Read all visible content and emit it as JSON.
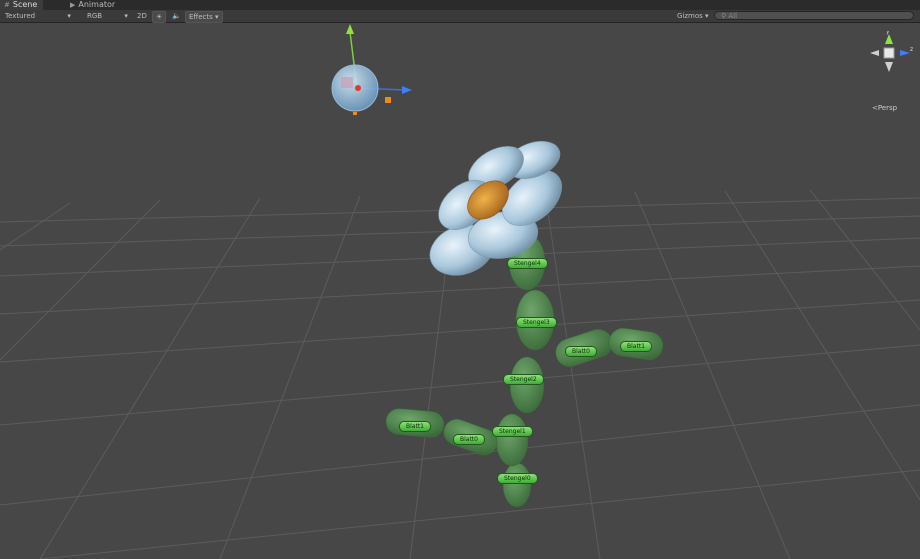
{
  "tabs": [
    {
      "label": "Scene",
      "icon": "scene-icon",
      "active": true
    },
    {
      "label": "Animator",
      "icon": "animator-icon",
      "active": false
    }
  ],
  "toolbar": {
    "draw_mode": "Textured",
    "render_mode": "RGB",
    "mode_2d": "2D",
    "lighting_icon": "sun-icon",
    "audio_icon": "speaker-icon",
    "effects": "Effects",
    "gizmos": "Gizmos",
    "search_placeholder": "All"
  },
  "viewport": {
    "projection_label": "Persp",
    "gizmo_axes": {
      "y": "y",
      "z": "z"
    },
    "bones": [
      {
        "label": "Stengel4"
      },
      {
        "label": "Stengel3"
      },
      {
        "label": "Stengel2"
      },
      {
        "label": "Stengel1"
      },
      {
        "label": "Stengel0"
      },
      {
        "label": "Blatt0"
      },
      {
        "label": "Blatt1"
      },
      {
        "label": "Blatt1"
      },
      {
        "label": "Blatt0"
      }
    ]
  },
  "colors": {
    "background": "#474747",
    "grid": "#5a5a5a",
    "bone_green": "#5fcf4e",
    "stem": "#4e8a4c",
    "petal": "#a9c7dc",
    "center": "#d28a2e"
  }
}
